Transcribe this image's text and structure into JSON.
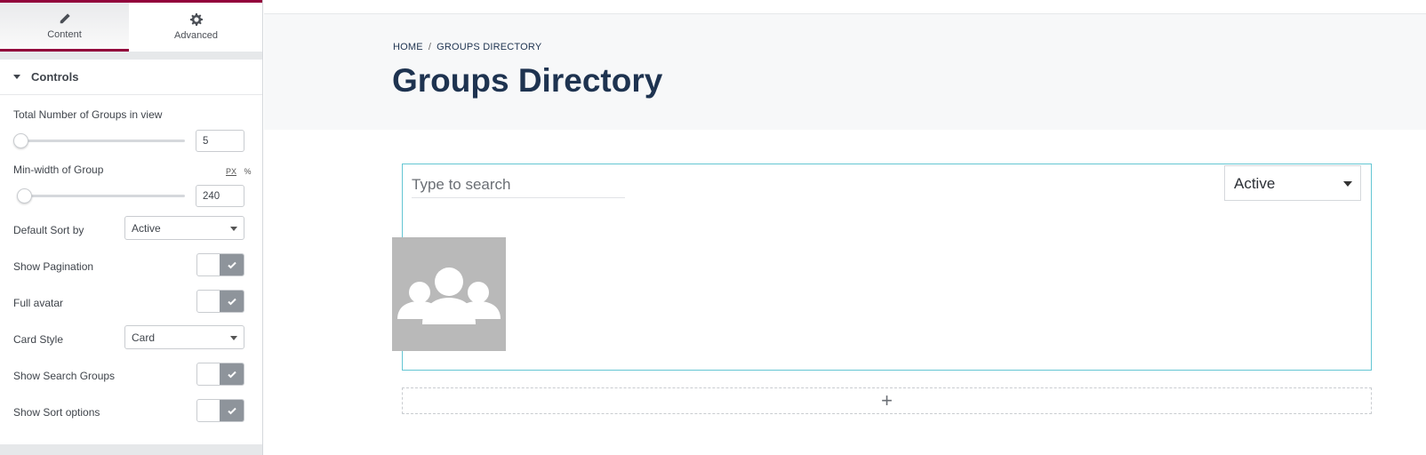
{
  "panel": {
    "tabs": [
      {
        "label": "Content",
        "icon": "pencil-icon",
        "active": true
      },
      {
        "label": "Advanced",
        "icon": "gear-icon",
        "active": false
      }
    ],
    "section_title": "Controls",
    "controls": {
      "total_groups": {
        "label": "Total Number of Groups in view",
        "value": "5"
      },
      "min_width": {
        "label": "Min-width of Group",
        "value": "240",
        "unit_px": "PX",
        "unit_pct": "%"
      },
      "default_sort": {
        "label": "Default Sort by",
        "value": "Active"
      },
      "show_pagination": {
        "label": "Show Pagination",
        "enabled": true
      },
      "full_avatar": {
        "label": "Full avatar",
        "enabled": true
      },
      "card_style": {
        "label": "Card Style",
        "value": "Card"
      },
      "show_search": {
        "label": "Show Search Groups",
        "enabled": true
      },
      "show_sort": {
        "label": "Show Sort options",
        "enabled": true
      }
    }
  },
  "preview": {
    "breadcrumb": {
      "home": "HOME",
      "separator": "/",
      "current": "GROUPS DIRECTORY"
    },
    "page_title": "Groups Directory",
    "search_placeholder": "Type to search",
    "sort_value": "Active",
    "add_section_symbol": "+"
  },
  "colors": {
    "accent": "#92003b",
    "title": "#1e3350",
    "widget_border": "#64c6d3",
    "toggle_on": "#8e949b",
    "avatar_bg": "#b9b9b9"
  }
}
